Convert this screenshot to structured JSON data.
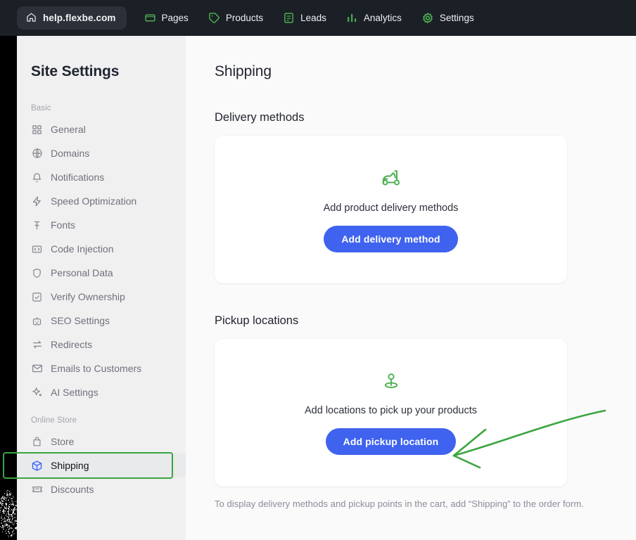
{
  "topbar": {
    "site_pill": {
      "icon": "home-icon",
      "label": "help.flexbe.com"
    },
    "nav": [
      {
        "icon": "pages-icon",
        "label": "Pages"
      },
      {
        "icon": "tag-icon",
        "label": "Products"
      },
      {
        "icon": "leads-icon",
        "label": "Leads"
      },
      {
        "icon": "analytics-icon",
        "label": "Analytics"
      },
      {
        "icon": "gear-icon",
        "label": "Settings"
      }
    ]
  },
  "sidebar": {
    "title": "Site Settings",
    "groups": [
      {
        "label": "Basic",
        "items": [
          {
            "icon": "grid-icon",
            "label": "General",
            "active": false
          },
          {
            "icon": "globe-icon",
            "label": "Domains",
            "active": false
          },
          {
            "icon": "bell-icon",
            "label": "Notifications",
            "active": false
          },
          {
            "icon": "bolt-icon",
            "label": "Speed Optimization",
            "active": false
          },
          {
            "icon": "font-icon",
            "label": "Fonts",
            "active": false
          },
          {
            "icon": "code-icon",
            "label": "Code Injection",
            "active": false
          },
          {
            "icon": "shield-icon",
            "label": "Personal Data",
            "active": false
          },
          {
            "icon": "checkbox-icon",
            "label": "Verify Ownership",
            "active": false
          },
          {
            "icon": "robot-icon",
            "label": "SEO Settings",
            "active": false
          },
          {
            "icon": "redirect-icon",
            "label": "Redirects",
            "active": false
          },
          {
            "icon": "mail-icon",
            "label": "Emails to Customers",
            "active": false
          },
          {
            "icon": "sparkle-icon",
            "label": "AI Settings",
            "active": false
          }
        ]
      },
      {
        "label": "Online Store",
        "items": [
          {
            "icon": "bag-icon",
            "label": "Store",
            "active": false
          },
          {
            "icon": "box-icon",
            "label": "Shipping",
            "active": true
          },
          {
            "icon": "ticket-icon",
            "label": "Discounts",
            "active": false
          }
        ]
      }
    ]
  },
  "main": {
    "page_title": "Shipping",
    "sections": [
      {
        "title": "Delivery methods",
        "icon": "scooter-icon",
        "empty_text": "Add product delivery methods",
        "button_label": "Add delivery method"
      },
      {
        "title": "Pickup locations",
        "icon": "map-pin-icon",
        "empty_text": "Add locations to pick up your products",
        "button_label": "Add pickup location"
      }
    ],
    "footnote": "To display delivery methods and pickup points in the cart, add “Shipping” to the order form."
  },
  "colors": {
    "accent_blue": "#3f63ef",
    "annotation_green": "#3aa53f",
    "topbar_icon_green": "#4caf50",
    "topbar_bg": "#1b1f26",
    "sidebar_bg": "#f0f0f1",
    "main_bg": "#fafafb",
    "shipping_icon_blue": "#3f63ef"
  }
}
